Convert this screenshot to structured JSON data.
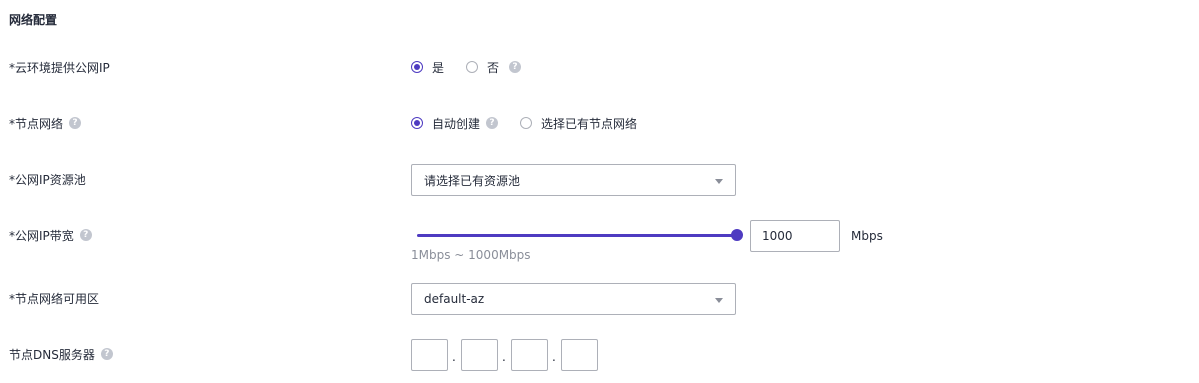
{
  "section_title": "网络配置",
  "help_glyph": "?",
  "rows": {
    "public_ip": {
      "label": "*云环境提供公网IP",
      "options": [
        "是",
        "否"
      ],
      "selected": "是"
    },
    "node_network": {
      "label": "*节点网络",
      "options": [
        "自动创建",
        "选择已有节点网络"
      ],
      "selected": "自动创建"
    },
    "ip_pool": {
      "label": "*公网IP资源池",
      "placeholder": "请选择已有资源池"
    },
    "bandwidth": {
      "label": "*公网IP带宽",
      "value": "1000",
      "unit": "Mbps",
      "range_hint": "1Mbps ~ 1000Mbps",
      "min": 1,
      "max": 1000
    },
    "availability_zone": {
      "label": "*节点网络可用区",
      "value": "default-az"
    },
    "dns": {
      "label": "节点DNS服务器",
      "octets": [
        "",
        "",
        "",
        ""
      ],
      "separator": "."
    }
  },
  "colors": {
    "accent": "#4e3bc1",
    "border": "#adb0b8",
    "text": "#252b3a",
    "muted": "#8a8e99",
    "help_icon_bg": "#c2c6cf"
  },
  "icons": {
    "help": "help-circle-icon",
    "dropdown": "caret-down-icon"
  }
}
